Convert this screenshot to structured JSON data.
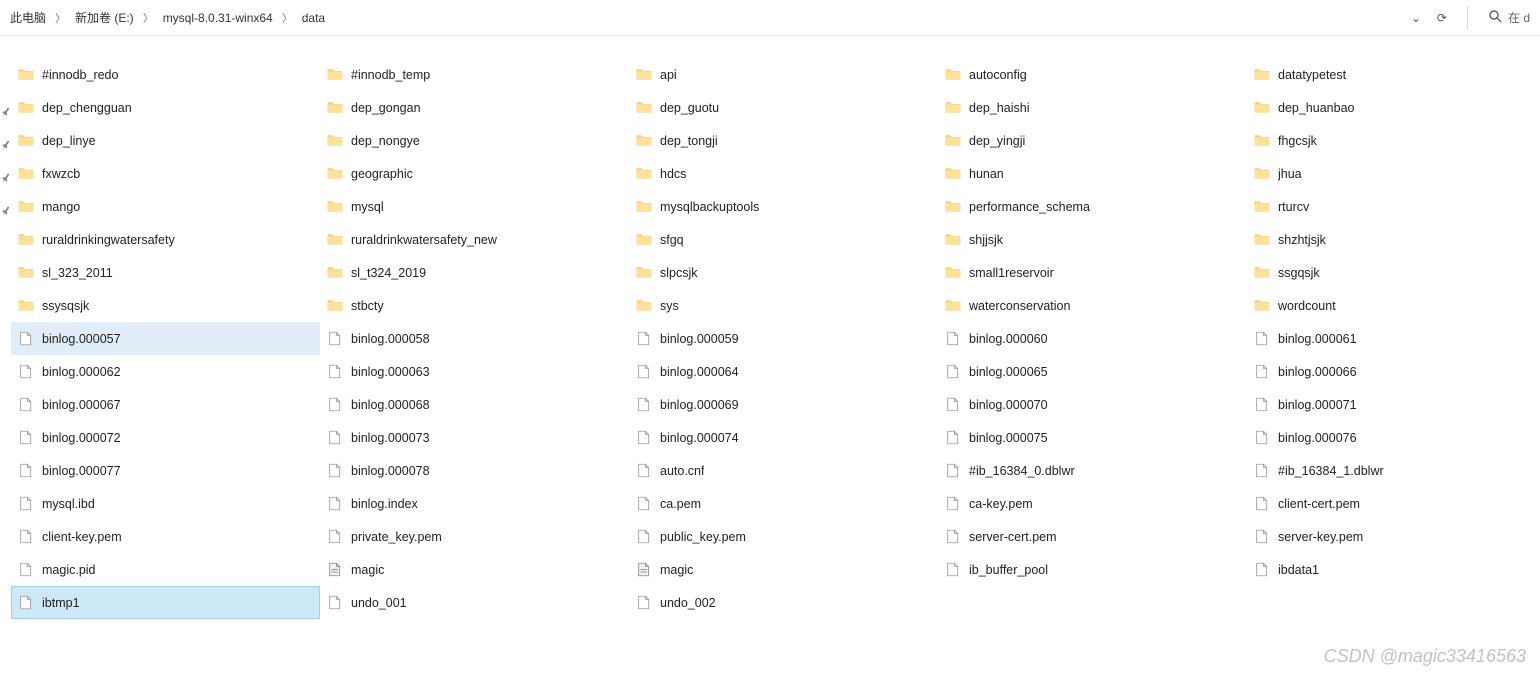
{
  "breadcrumb": [
    "此电脑",
    "新加卷 (E:)",
    "mysql-8.0.31-winx64",
    "data"
  ],
  "search_placeholder": "在 d",
  "watermark": "CSDN @magic33416563",
  "columns": [
    [
      {
        "type": "folder",
        "name": "#innodb_redo",
        "state": ""
      },
      {
        "type": "folder",
        "name": "dep_chengguan",
        "state": "",
        "pin": true
      },
      {
        "type": "folder",
        "name": "dep_linye",
        "state": "",
        "pin": true
      },
      {
        "type": "folder",
        "name": "fxwzcb",
        "state": "",
        "pin": true
      },
      {
        "type": "folder",
        "name": "mango",
        "state": "",
        "pin": true
      },
      {
        "type": "folder",
        "name": "ruraldrinkingwatersafety",
        "state": ""
      },
      {
        "type": "folder",
        "name": "sl_323_2011",
        "state": ""
      },
      {
        "type": "folder",
        "name": "ssysqsjk",
        "state": ""
      },
      {
        "type": "file",
        "name": "binlog.000057",
        "state": "selected-light"
      },
      {
        "type": "file",
        "name": "binlog.000062",
        "state": ""
      },
      {
        "type": "file",
        "name": "binlog.000067",
        "state": ""
      },
      {
        "type": "file",
        "name": "binlog.000072",
        "state": ""
      },
      {
        "type": "file",
        "name": "binlog.000077",
        "state": ""
      },
      {
        "type": "file",
        "name": "mysql.ibd",
        "state": ""
      },
      {
        "type": "file",
        "name": "client-key.pem",
        "state": ""
      },
      {
        "type": "file",
        "name": "magic.pid",
        "state": ""
      },
      {
        "type": "file",
        "name": "ibtmp1",
        "state": "selected-strong"
      }
    ],
    [
      {
        "type": "folder",
        "name": "#innodb_temp",
        "state": ""
      },
      {
        "type": "folder",
        "name": "dep_gongan",
        "state": ""
      },
      {
        "type": "folder",
        "name": "dep_nongye",
        "state": ""
      },
      {
        "type": "folder",
        "name": "geographic",
        "state": ""
      },
      {
        "type": "folder",
        "name": "mysql",
        "state": ""
      },
      {
        "type": "folder",
        "name": "ruraldrinkwatersafety_new",
        "state": ""
      },
      {
        "type": "folder",
        "name": "sl_t324_2019",
        "state": ""
      },
      {
        "type": "folder",
        "name": "stbcty",
        "state": ""
      },
      {
        "type": "file",
        "name": "binlog.000058",
        "state": ""
      },
      {
        "type": "file",
        "name": "binlog.000063",
        "state": ""
      },
      {
        "type": "file",
        "name": "binlog.000068",
        "state": ""
      },
      {
        "type": "file",
        "name": "binlog.000073",
        "state": ""
      },
      {
        "type": "file",
        "name": "binlog.000078",
        "state": ""
      },
      {
        "type": "file",
        "name": "binlog.index",
        "state": ""
      },
      {
        "type": "file",
        "name": "private_key.pem",
        "state": ""
      },
      {
        "type": "file",
        "name": "magic",
        "state": "",
        "icon": "bin"
      },
      {
        "type": "file",
        "name": "undo_001",
        "state": ""
      }
    ],
    [
      {
        "type": "folder",
        "name": "api",
        "state": ""
      },
      {
        "type": "folder",
        "name": "dep_guotu",
        "state": ""
      },
      {
        "type": "folder",
        "name": "dep_tongji",
        "state": ""
      },
      {
        "type": "folder",
        "name": "hdcs",
        "state": ""
      },
      {
        "type": "folder",
        "name": "mysqlbackuptools",
        "state": ""
      },
      {
        "type": "folder",
        "name": "sfgq",
        "state": ""
      },
      {
        "type": "folder",
        "name": "slpcsjk",
        "state": ""
      },
      {
        "type": "folder",
        "name": "sys",
        "state": ""
      },
      {
        "type": "file",
        "name": "binlog.000059",
        "state": ""
      },
      {
        "type": "file",
        "name": "binlog.000064",
        "state": ""
      },
      {
        "type": "file",
        "name": "binlog.000069",
        "state": ""
      },
      {
        "type": "file",
        "name": "binlog.000074",
        "state": ""
      },
      {
        "type": "file",
        "name": "auto.cnf",
        "state": ""
      },
      {
        "type": "file",
        "name": "ca.pem",
        "state": ""
      },
      {
        "type": "file",
        "name": "public_key.pem",
        "state": ""
      },
      {
        "type": "file",
        "name": "magic",
        "state": "",
        "icon": "bin"
      },
      {
        "type": "file",
        "name": "undo_002",
        "state": ""
      }
    ],
    [
      {
        "type": "folder",
        "name": "autoconfig",
        "state": ""
      },
      {
        "type": "folder",
        "name": "dep_haishi",
        "state": ""
      },
      {
        "type": "folder",
        "name": "dep_yingji",
        "state": ""
      },
      {
        "type": "folder",
        "name": "hunan",
        "state": ""
      },
      {
        "type": "folder",
        "name": "performance_schema",
        "state": ""
      },
      {
        "type": "folder",
        "name": "shjjsjk",
        "state": ""
      },
      {
        "type": "folder",
        "name": "small1reservoir",
        "state": ""
      },
      {
        "type": "folder",
        "name": "waterconservation",
        "state": ""
      },
      {
        "type": "file",
        "name": "binlog.000060",
        "state": ""
      },
      {
        "type": "file",
        "name": "binlog.000065",
        "state": ""
      },
      {
        "type": "file",
        "name": "binlog.000070",
        "state": ""
      },
      {
        "type": "file",
        "name": "binlog.000075",
        "state": ""
      },
      {
        "type": "file",
        "name": "#ib_16384_0.dblwr",
        "state": ""
      },
      {
        "type": "file",
        "name": "ca-key.pem",
        "state": ""
      },
      {
        "type": "file",
        "name": "server-cert.pem",
        "state": ""
      },
      {
        "type": "file",
        "name": "ib_buffer_pool",
        "state": ""
      }
    ],
    [
      {
        "type": "folder",
        "name": "datatypetest",
        "state": ""
      },
      {
        "type": "folder",
        "name": "dep_huanbao",
        "state": ""
      },
      {
        "type": "folder",
        "name": "fhgcsjk",
        "state": ""
      },
      {
        "type": "folder",
        "name": "jhua",
        "state": ""
      },
      {
        "type": "folder",
        "name": "rturcv",
        "state": ""
      },
      {
        "type": "folder",
        "name": "shzhtjsjk",
        "state": ""
      },
      {
        "type": "folder",
        "name": "ssgqsjk",
        "state": ""
      },
      {
        "type": "folder",
        "name": "wordcount",
        "state": ""
      },
      {
        "type": "file",
        "name": "binlog.000061",
        "state": ""
      },
      {
        "type": "file",
        "name": "binlog.000066",
        "state": ""
      },
      {
        "type": "file",
        "name": "binlog.000071",
        "state": ""
      },
      {
        "type": "file",
        "name": "binlog.000076",
        "state": ""
      },
      {
        "type": "file",
        "name": "#ib_16384_1.dblwr",
        "state": ""
      },
      {
        "type": "file",
        "name": "client-cert.pem",
        "state": ""
      },
      {
        "type": "file",
        "name": "server-key.pem",
        "state": ""
      },
      {
        "type": "file",
        "name": "ibdata1",
        "state": ""
      }
    ]
  ]
}
